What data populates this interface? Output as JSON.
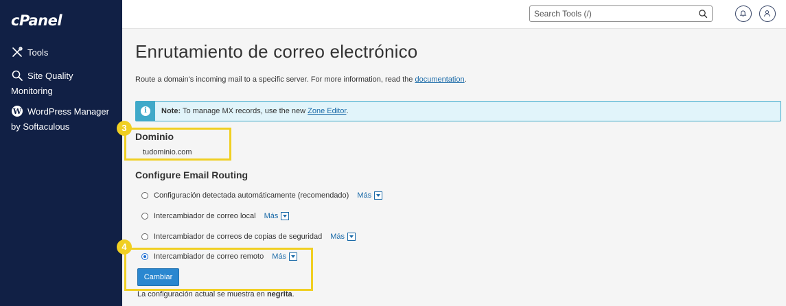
{
  "sidebar": {
    "logo": "cPanel",
    "items": [
      {
        "label": "Tools",
        "icon": "tools-icon"
      },
      {
        "label": "Site Quality Monitoring",
        "icon": "search-icon"
      },
      {
        "label": "WordPress Manager by Softaculous",
        "icon": "wordpress-icon"
      }
    ]
  },
  "header": {
    "search_placeholder": "Search Tools (/)"
  },
  "main": {
    "title": "Enrutamiento de correo electrónico",
    "description_prefix": "Route a domain's incoming mail to a specific server. For more information, read the ",
    "description_link": "documentation",
    "description_suffix": ".",
    "note_label": "Note:",
    "note_text": " To manage MX records, use the new ",
    "note_link": "Zone Editor",
    "note_suffix": ".",
    "domain_heading": "Dominio",
    "domain_value": "tudominio.com",
    "config_heading": "Configure Email Routing",
    "options": [
      {
        "label": "Configuración detectada automáticamente (recomendado)",
        "more": "Más",
        "checked": false
      },
      {
        "label": "Intercambiador de correo local",
        "more": "Más",
        "checked": false
      },
      {
        "label": "Intercambiador de correos de copias de seguridad",
        "more": "Más",
        "checked": false
      },
      {
        "label": "Intercambiador de correo remoto",
        "more": "Más",
        "checked": true
      }
    ],
    "submit_label": "Cambiar",
    "footnote_prefix": "La configuración actual se muestra en ",
    "footnote_bold": "negrita",
    "footnote_suffix": "."
  },
  "annotations": {
    "badge_3": "3",
    "badge_4": "4",
    "highlight_color": "#f0cf22"
  },
  "colors": {
    "sidebar_bg": "#112045",
    "accent": "#2a87d0",
    "note_border": "#3fa9c9"
  }
}
